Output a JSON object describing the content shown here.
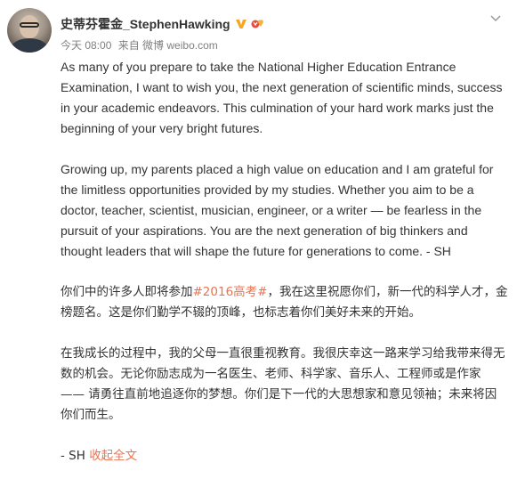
{
  "post": {
    "username": "史蒂芬霍金_StephenHawking",
    "meta": {
      "time": "今天 08:00",
      "source": "来自 微博 weibo.com"
    },
    "paragraphs_en": [
      "As many of you prepare to take the National Higher Education Entrance Examination, I want to wish you, the next generation of scientific minds, success in your academic endeavors. This culmination of your hard work marks just the beginning of your very bright futures.",
      "Growing up, my parents placed a high value on education and I am grateful for the limitless opportunities provided by my studies. Whether you aim to be a doctor, teacher, scientist, musician, engineer, or a writer — be fearless in the pursuit of your aspirations. You are the next generation of big thinkers and thought leaders that will shape the future for generations to come. - SH"
    ],
    "cn_para1": {
      "before": "你们中的许多人即将参加",
      "hashtag": "#2016高考#",
      "after": "，我在这里祝愿你们，新一代的科学人才，金榜题名。这是你们勤学不辍的顶峰，也标志着你们美好未来的开始。"
    },
    "cn_para2": "在我成长的过程中，我的父母一直很重视教育。我很庆幸这一路来学习给我带来得无数的机会。无论你励志成为一名医生、老师、科学家、音乐人、工程师或是作家 —— 请勇往直前地追逐你的梦想。你们是下一代的大思想家和意见领袖；未来将因你们而生。",
    "signature": "- SH",
    "collapse_label": "收起全文"
  },
  "icons": {
    "verified": "verified-v-icon",
    "badge": "fan-badge-icon",
    "menu": "chevron-down-icon"
  },
  "colors": {
    "text": "#333333",
    "meta": "#808080",
    "link": "#eb7350",
    "verified": "#f5a623"
  }
}
